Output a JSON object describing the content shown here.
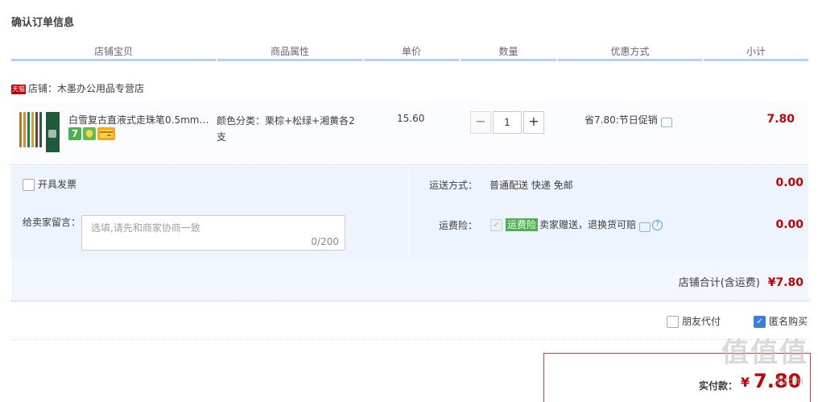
{
  "page_title": "确认订单信息",
  "columns": [
    "店铺宝贝",
    "商品属性",
    "单价",
    "数量",
    "优惠方式",
    "小计"
  ],
  "shop": {
    "badge": "天猫",
    "label": "店铺：木墨办公用品专营店"
  },
  "item": {
    "name": "白雪复古直液式走珠笔0.5mm…",
    "badge_icons": [
      "seven-day-return-icon",
      "guarantee-icon",
      "credit-card-icon"
    ],
    "badge_seven": "7",
    "attr": "颜色分类：栗棕+松绿+湘黄各2支",
    "price": "15.60",
    "qty_minus": "−",
    "qty": "1",
    "qty_plus": "+",
    "promo": "省7.80:节日促销",
    "subtotal": "7.80"
  },
  "invoice": {
    "label": "开具发票",
    "checked": false
  },
  "shipping": {
    "label": "运送方式：",
    "value": "普通配送 快递 免邮",
    "fee": "0.00"
  },
  "message": {
    "label": "给卖家留言：",
    "placeholder": "选填,请先和商家协商一致",
    "counter": "0/200"
  },
  "insurance": {
    "label": "运费险：",
    "tag": "运费险",
    "text": "卖家赠送，退换货可赔",
    "fee": "0.00",
    "checked": true
  },
  "shop_total": {
    "label": "店铺合计(含运费)",
    "value": "¥7.80"
  },
  "options": [
    {
      "label": "朋友代付",
      "checked": false
    },
    {
      "label": "匿名购买",
      "checked": true
    }
  ],
  "pay": {
    "label": "实付款：",
    "currency": "¥",
    "value": "7.80"
  },
  "watermark": {
    "text": "值值值",
    "sub": "hzdm"
  },
  "colors": {
    "accent": "#c40000",
    "header_line": "#b2d1ff",
    "insurance_tag": "#4caf50",
    "checkbox_on": "#3d7fd6"
  }
}
